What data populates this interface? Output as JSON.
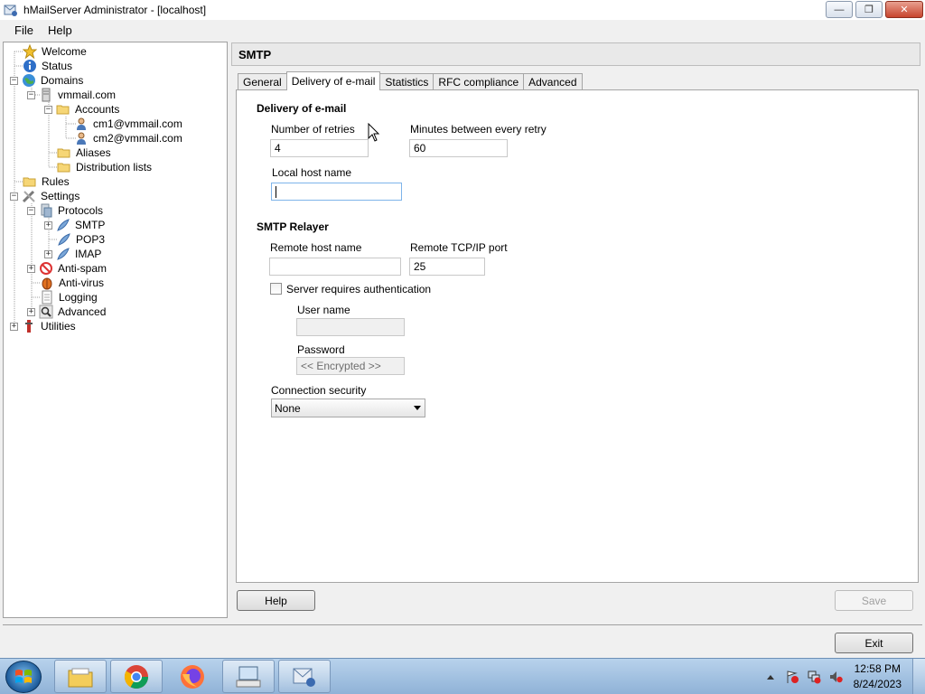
{
  "window": {
    "title": "hMailServer Administrator - [localhost]"
  },
  "menu": {
    "items": [
      "File",
      "Help"
    ]
  },
  "tree": {
    "welcome": "Welcome",
    "status": "Status",
    "domains": "Domains",
    "domain1": "vmmail.com",
    "accounts": "Accounts",
    "account1": "cm1@vmmail.com",
    "account2": "cm2@vmmail.com",
    "aliases": "Aliases",
    "distribution_lists": "Distribution lists",
    "rules": "Rules",
    "settings": "Settings",
    "protocols": "Protocols",
    "smtp": "SMTP",
    "pop3": "POP3",
    "imap": "IMAP",
    "antispam": "Anti-spam",
    "antivirus": "Anti-virus",
    "logging": "Logging",
    "advanced": "Advanced",
    "utilities": "Utilities"
  },
  "header": {
    "title": "SMTP"
  },
  "tabs": [
    "General",
    "Delivery of e-mail",
    "Statistics",
    "RFC compliance",
    "Advanced"
  ],
  "delivery": {
    "section_title": "Delivery of e-mail",
    "retries_label": "Number of retries",
    "retries_value": "4",
    "minutes_label": "Minutes between every retry",
    "minutes_value": "60",
    "localhost_label": "Local host name",
    "localhost_value": ""
  },
  "relayer": {
    "section_title": "SMTP Relayer",
    "remote_host_label": "Remote host name",
    "remote_host_value": "",
    "port_label": "Remote TCP/IP port",
    "port_value": "25",
    "auth_label": "Server requires authentication",
    "username_label": "User name",
    "username_value": "",
    "password_label": "Password",
    "password_value": "<< Encrypted >>",
    "security_label": "Connection security",
    "security_value": "None"
  },
  "buttons": {
    "help": "Help",
    "save": "Save",
    "exit": "Exit"
  },
  "taskbar": {
    "time": "12:58 PM",
    "date": "8/24/2023"
  }
}
